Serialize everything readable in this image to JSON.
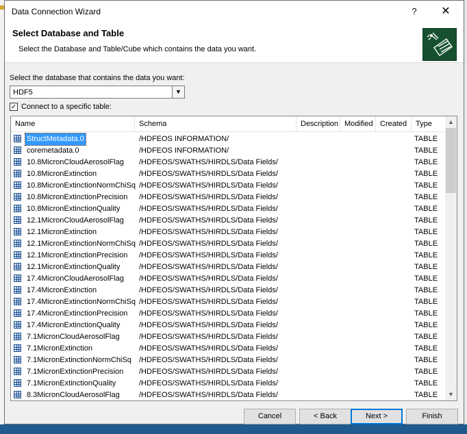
{
  "window": {
    "title": "Data Connection Wizard",
    "help_glyph": "?",
    "close_glyph": "✕"
  },
  "header": {
    "title": "Select Database and Table",
    "subtitle": "Select the Database and Table/Cube which contains the data you want.",
    "logo_icon": "wizard-database-icon"
  },
  "database": {
    "label": "Select the database that contains the data you want:",
    "selected": "HDF5"
  },
  "connect_specific": {
    "label": "Connect to a specific table:",
    "checked": true
  },
  "table": {
    "columns": [
      "Name",
      "Schema",
      "Description",
      "Modified",
      "Created",
      "Type"
    ],
    "rows": [
      {
        "name": "StructMetadata.0",
        "schema": "/HDFEOS INFORMATION/",
        "type": "TABLE",
        "selected": true
      },
      {
        "name": "coremetadata.0",
        "schema": "/HDFEOS INFORMATION/",
        "type": "TABLE"
      },
      {
        "name": "10.8MicronCloudAerosolFlag",
        "schema": "/HDFEOS/SWATHS/HIRDLS/Data Fields/",
        "type": "TABLE"
      },
      {
        "name": "10.8MicronExtinction",
        "schema": "/HDFEOS/SWATHS/HIRDLS/Data Fields/",
        "type": "TABLE"
      },
      {
        "name": "10.8MicronExtinctionNormChiSq",
        "schema": "/HDFEOS/SWATHS/HIRDLS/Data Fields/",
        "type": "TABLE"
      },
      {
        "name": "10.8MicronExtinctionPrecision",
        "schema": "/HDFEOS/SWATHS/HIRDLS/Data Fields/",
        "type": "TABLE"
      },
      {
        "name": "10.8MicronExtinctionQuality",
        "schema": "/HDFEOS/SWATHS/HIRDLS/Data Fields/",
        "type": "TABLE"
      },
      {
        "name": "12.1MicronCloudAerosolFlag",
        "schema": "/HDFEOS/SWATHS/HIRDLS/Data Fields/",
        "type": "TABLE"
      },
      {
        "name": "12.1MicronExtinction",
        "schema": "/HDFEOS/SWATHS/HIRDLS/Data Fields/",
        "type": "TABLE"
      },
      {
        "name": "12.1MicronExtinctionNormChiSq",
        "schema": "/HDFEOS/SWATHS/HIRDLS/Data Fields/",
        "type": "TABLE"
      },
      {
        "name": "12.1MicronExtinctionPrecision",
        "schema": "/HDFEOS/SWATHS/HIRDLS/Data Fields/",
        "type": "TABLE"
      },
      {
        "name": "12.1MicronExtinctionQuality",
        "schema": "/HDFEOS/SWATHS/HIRDLS/Data Fields/",
        "type": "TABLE"
      },
      {
        "name": "17.4MicronCloudAerosolFlag",
        "schema": "/HDFEOS/SWATHS/HIRDLS/Data Fields/",
        "type": "TABLE"
      },
      {
        "name": "17.4MicronExtinction",
        "schema": "/HDFEOS/SWATHS/HIRDLS/Data Fields/",
        "type": "TABLE"
      },
      {
        "name": "17.4MicronExtinctionNormChiSq",
        "schema": "/HDFEOS/SWATHS/HIRDLS/Data Fields/",
        "type": "TABLE"
      },
      {
        "name": "17.4MicronExtinctionPrecision",
        "schema": "/HDFEOS/SWATHS/HIRDLS/Data Fields/",
        "type": "TABLE"
      },
      {
        "name": "17.4MicronExtinctionQuality",
        "schema": "/HDFEOS/SWATHS/HIRDLS/Data Fields/",
        "type": "TABLE"
      },
      {
        "name": "7.1MicronCloudAerosolFlag",
        "schema": "/HDFEOS/SWATHS/HIRDLS/Data Fields/",
        "type": "TABLE"
      },
      {
        "name": "7.1MicronExtinction",
        "schema": "/HDFEOS/SWATHS/HIRDLS/Data Fields/",
        "type": "TABLE"
      },
      {
        "name": "7.1MicronExtinctionNormChiSq",
        "schema": "/HDFEOS/SWATHS/HIRDLS/Data Fields/",
        "type": "TABLE"
      },
      {
        "name": "7.1MicronExtinctionPrecision",
        "schema": "/HDFEOS/SWATHS/HIRDLS/Data Fields/",
        "type": "TABLE"
      },
      {
        "name": "7.1MicronExtinctionQuality",
        "schema": "/HDFEOS/SWATHS/HIRDLS/Data Fields/",
        "type": "TABLE"
      },
      {
        "name": "8.3MicronCloudAerosolFlag",
        "schema": "/HDFEOS/SWATHS/HIRDLS/Data Fields/",
        "type": "TABLE"
      }
    ]
  },
  "buttons": {
    "cancel": "Cancel",
    "back": "< Back",
    "next": "Next >",
    "finish": "Finish"
  },
  "colors": {
    "selection": "#3399ff",
    "default_button_border": "#0078d7"
  }
}
